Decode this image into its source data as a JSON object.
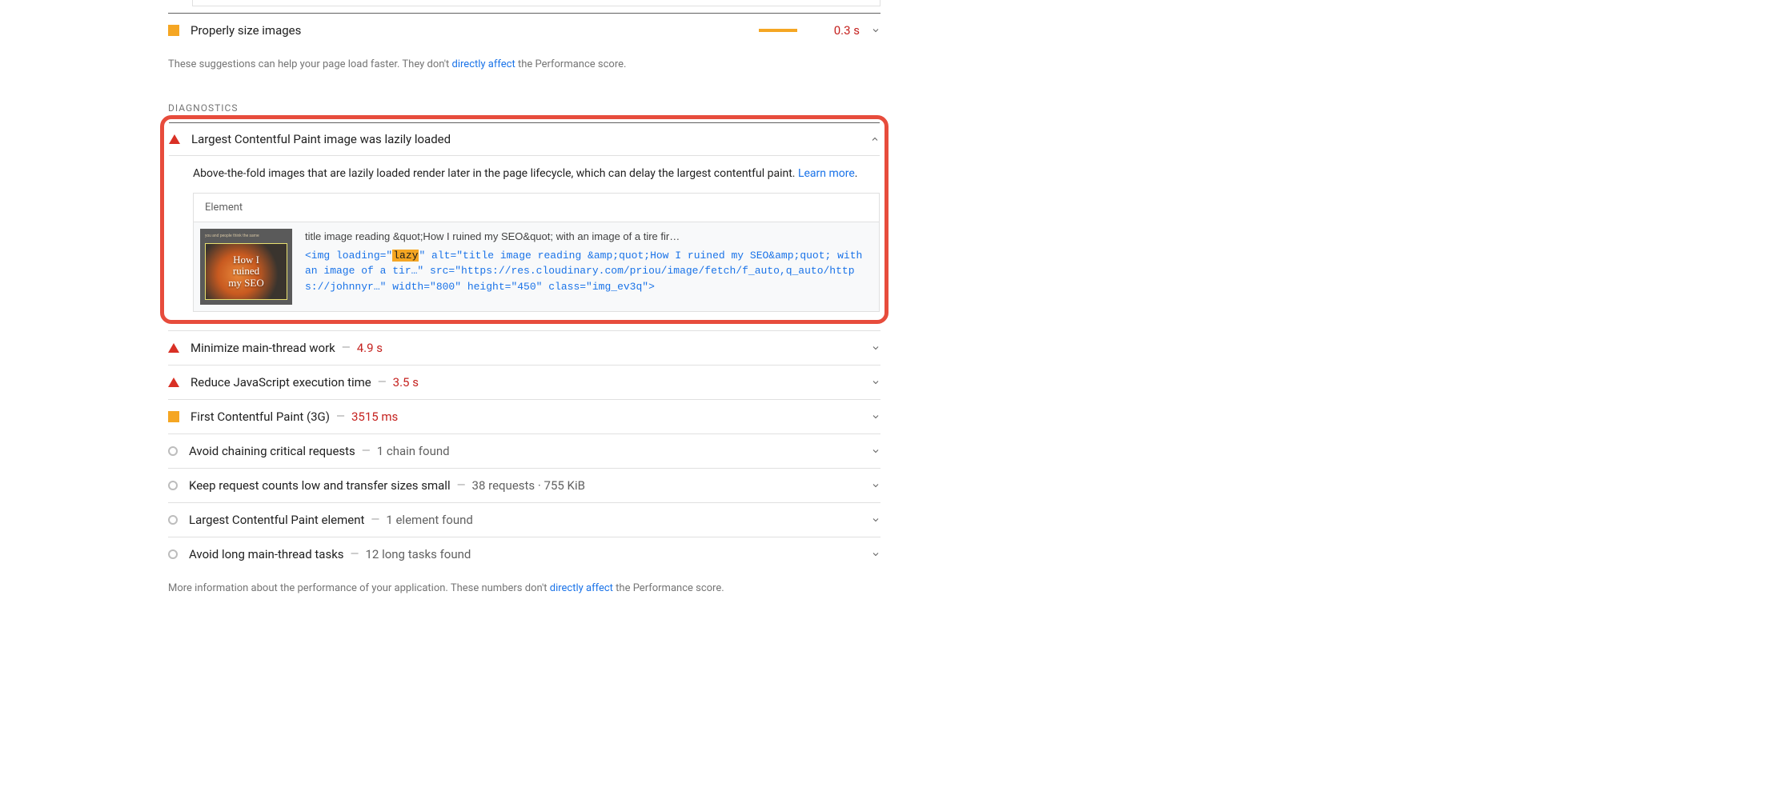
{
  "opportunities": {
    "items": [
      {
        "title": "Properly size images",
        "value": "0.3 s",
        "bar_pct": 60
      }
    ],
    "footer_pre": "These suggestions can help your page load faster. They don't ",
    "footer_link": "directly affect",
    "footer_post": " the Performance score."
  },
  "diagnostics": {
    "header": "DIAGNOSTICS",
    "expanded": {
      "title": "Largest Contentful Paint image was lazily loaded",
      "desc_pre": "Above-the-fold images that are lazily loaded render later in the page lifecycle, which can delay the largest contentful paint. ",
      "desc_link": "Learn more",
      "desc_post": ".",
      "element_header": "Element",
      "thumb_caption": "you and people think the same",
      "thumb_line1": "How I",
      "thumb_line2": "ruined",
      "thumb_line3": "my SEO",
      "snippet_title": "title image reading &quot;How I ruined my SEO&quot; with an image of a tire fir…",
      "code_pre": "<img loading=\"",
      "code_hl": "lazy",
      "code_post": "\" alt=\"title image reading &amp;quot;How I ruined my SEO&amp;quot; with an image of a tir…\" src=\"https://res.cloudinary.com/priou/image/fetch/f_auto,q_auto/https://johnnyr…\" width=\"800\" height=\"450\" class=\"img_ev3q\">"
    },
    "items": [
      {
        "icon": "triangle",
        "title": "Minimize main-thread work",
        "metric": "4.9 s",
        "metric_style": "red"
      },
      {
        "icon": "triangle",
        "title": "Reduce JavaScript execution time",
        "metric": "3.5 s",
        "metric_style": "red"
      },
      {
        "icon": "square",
        "title": "First Contentful Paint (3G)",
        "metric": "3515 ms",
        "metric_style": "red"
      },
      {
        "icon": "circle",
        "title": "Avoid chaining critical requests",
        "metric": "1 chain found",
        "metric_style": "gray"
      },
      {
        "icon": "circle",
        "title": "Keep request counts low and transfer sizes small",
        "metric": "38 requests · 755 KiB",
        "metric_style": "gray"
      },
      {
        "icon": "circle",
        "title": "Largest Contentful Paint element",
        "metric": "1 element found",
        "metric_style": "gray"
      },
      {
        "icon": "circle",
        "title": "Avoid long main-thread tasks",
        "metric": "12 long tasks found",
        "metric_style": "gray"
      }
    ],
    "footer_pre": "More information about the performance of your application. These numbers don't ",
    "footer_link": "directly affect",
    "footer_post": " the Performance score."
  }
}
